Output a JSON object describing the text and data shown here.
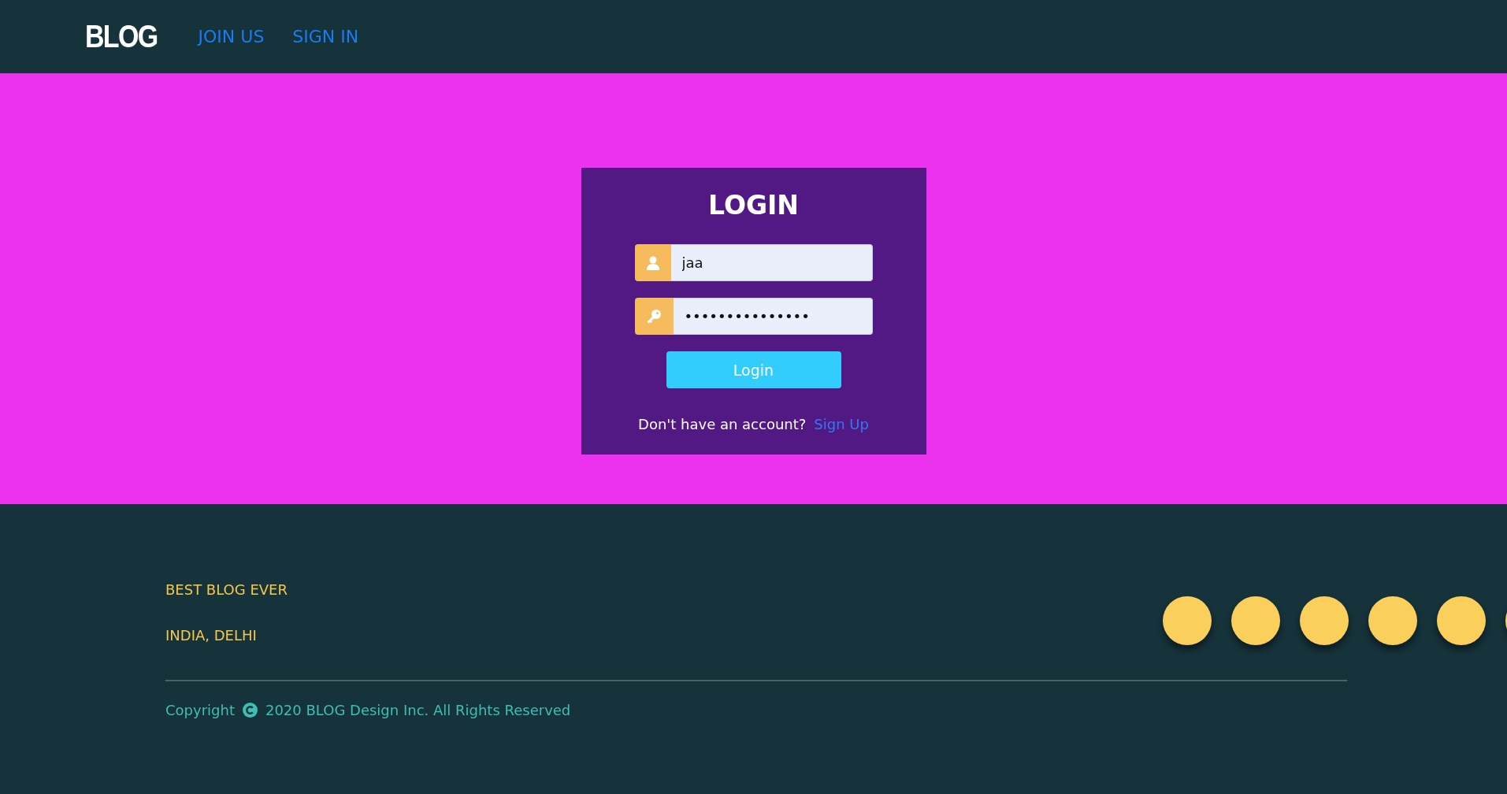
{
  "header": {
    "logo": "BLOG",
    "nav": [
      {
        "label": "JOIN US"
      },
      {
        "label": "SIGN IN"
      }
    ]
  },
  "login": {
    "title": "LOGIN",
    "fields": [
      {
        "kind": "user",
        "value": "jaa"
      },
      {
        "kind": "password",
        "value": "•••••••••••••••"
      }
    ],
    "button": "Login",
    "prompt": "Don't have an account?",
    "link": "Sign Up"
  },
  "footer": {
    "lines": [
      "BEST BLOG EVER",
      "INDIA, DELHI"
    ],
    "copyright_label": "Copyright",
    "copyright_text": "2020 BLOG Design Inc. All Rights Reserved"
  }
}
